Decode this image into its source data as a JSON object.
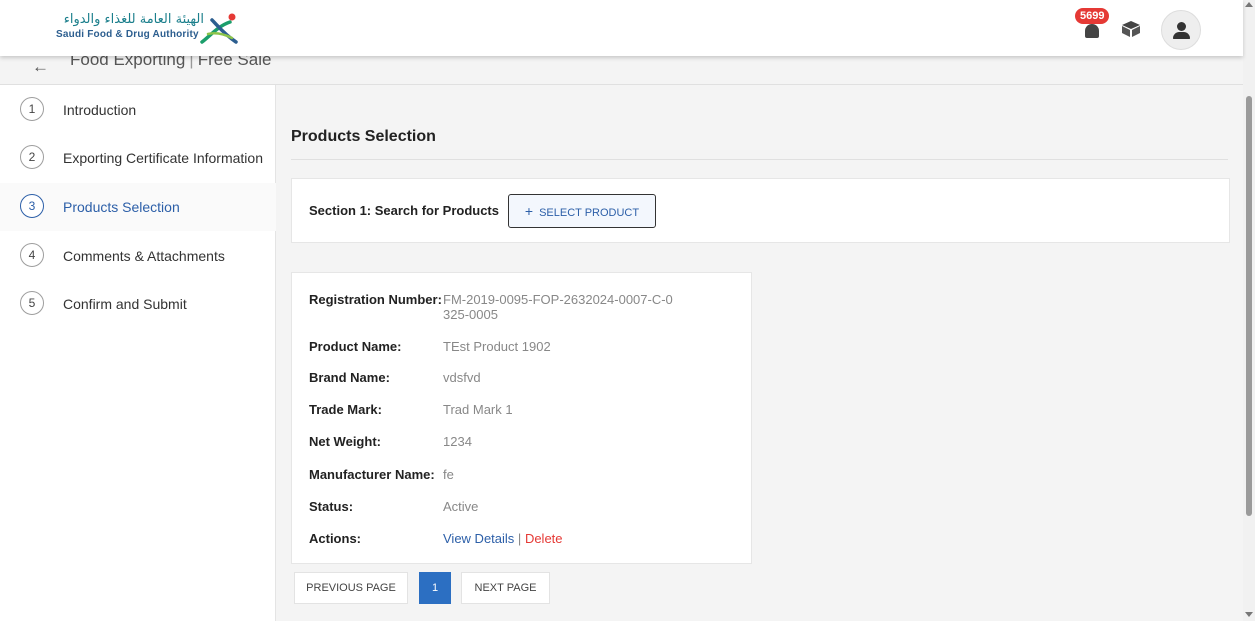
{
  "header": {
    "logo_arabic": "الهيئة العامة للغذاء والدواء",
    "logo_english": "Saudi Food & Drug Authority",
    "notification_count": "5699",
    "brand_color": "#2c5fa8"
  },
  "breadcrumb": {
    "section": "Food Exporting",
    "page": "Free Sale"
  },
  "steps": [
    {
      "num": "1",
      "label": "Introduction"
    },
    {
      "num": "2",
      "label": "Exporting Certificate Information"
    },
    {
      "num": "3",
      "label": "Products Selection"
    },
    {
      "num": "4",
      "label": "Comments & Attachments"
    },
    {
      "num": "5",
      "label": "Confirm and Submit"
    }
  ],
  "active_step": "3",
  "main": {
    "title": "Products Selection",
    "search_label": "Section 1: Search for Products",
    "select_button": "SELECT PRODUCT"
  },
  "product": {
    "labels": {
      "registration": "Registration Number:",
      "name": "Product Name:",
      "brand": "Brand Name:",
      "trademark": "Trade Mark:",
      "weight": "Net Weight:",
      "manufacturer": "Manufacturer Name:",
      "status": "Status:",
      "actions": "Actions:"
    },
    "values": {
      "registration": "FM-2019-0095-FOP-2632024-0007-C-0325-0005",
      "name": "TEst Product 1902",
      "brand": "vdsfvd",
      "trademark": "Trad Mark 1",
      "weight": "1234",
      "manufacturer": "fe",
      "status": "Active"
    },
    "actions": {
      "view": "View Details",
      "separator": "|",
      "delete": "Delete"
    }
  },
  "pager": {
    "prev": "PREVIOUS PAGE",
    "current": "1",
    "next": "NEXT PAGE"
  }
}
